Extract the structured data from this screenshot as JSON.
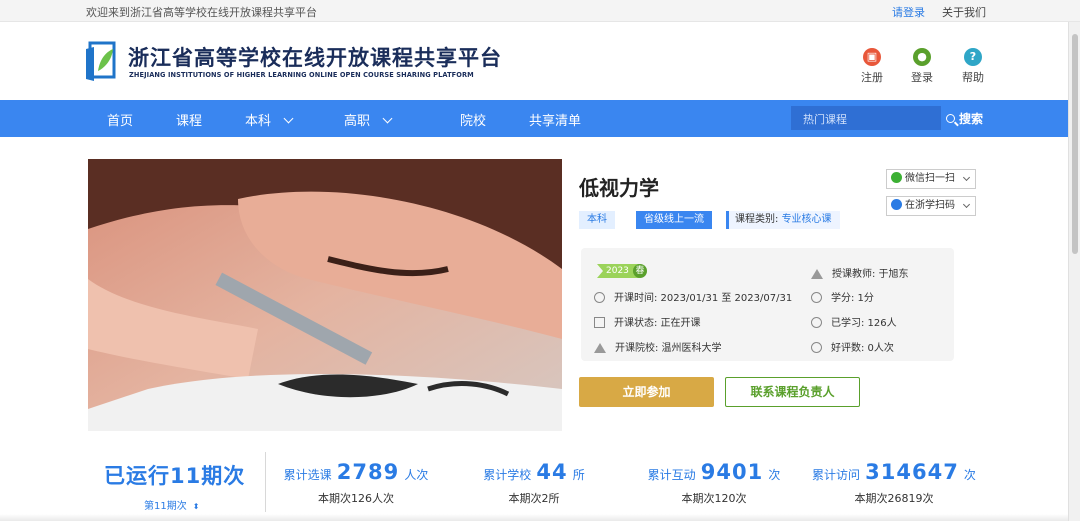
{
  "topbar": {
    "welcome": "欢迎来到浙江省高等学校在线开放课程共享平台",
    "login": "请登录",
    "about": "关于我们"
  },
  "site": {
    "title": "浙江省高等学校在线开放课程共享平台",
    "subtitle": "ZHEJIANG INSTITUTIONS OF HIGHER LEARNING ONLINE OPEN COURSE SHARING PLATFORM",
    "actions": [
      {
        "label": "注册",
        "icon": "register-icon",
        "color": "#e8573a"
      },
      {
        "label": "登录",
        "icon": "user-icon",
        "color": "#5aa02c"
      },
      {
        "label": "帮助",
        "icon": "help-icon",
        "color": "#2fa6c7"
      }
    ]
  },
  "nav": {
    "items": [
      "首页",
      "课程",
      "本科",
      "高职",
      "院校",
      "共享清单"
    ],
    "search_placeholder": "热门课程",
    "search_label": "搜索"
  },
  "course": {
    "title": "低视力学",
    "tags": {
      "level": "本科",
      "grade": "省级线上一流",
      "category_label": "课程类别:",
      "category_value": "专业核心课"
    },
    "share": {
      "wechat": "微信扫一扫",
      "zjx": "在浙学扫码"
    },
    "year": "2023",
    "season": "春",
    "open_time": "开课时间: 2023/01/31 至 2023/07/31",
    "status": "开课状态: 正在开课",
    "school": "开课院校: 温州医科大学",
    "teacher": "授课教师: 于旭东",
    "credit": "学分: 1分",
    "learned": "已学习: 126人",
    "rating": "好评数: 0人次",
    "join": "立即参加",
    "contact": "联系课程负责人"
  },
  "stats": {
    "run_label": "已运行11期次",
    "period": "第11期次",
    "items": [
      {
        "pre": "累计选课",
        "num": "2789",
        "unit": "人次",
        "sub": "本期次126人次"
      },
      {
        "pre": "累计学校",
        "num": "44",
        "unit": "所",
        "sub": "本期次2所"
      },
      {
        "pre": "累计互动",
        "num": "9401",
        "unit": "次",
        "sub": "本期次120次"
      },
      {
        "pre": "累计访问",
        "num": "314647",
        "unit": "次",
        "sub": "本期次26819次"
      }
    ]
  }
}
